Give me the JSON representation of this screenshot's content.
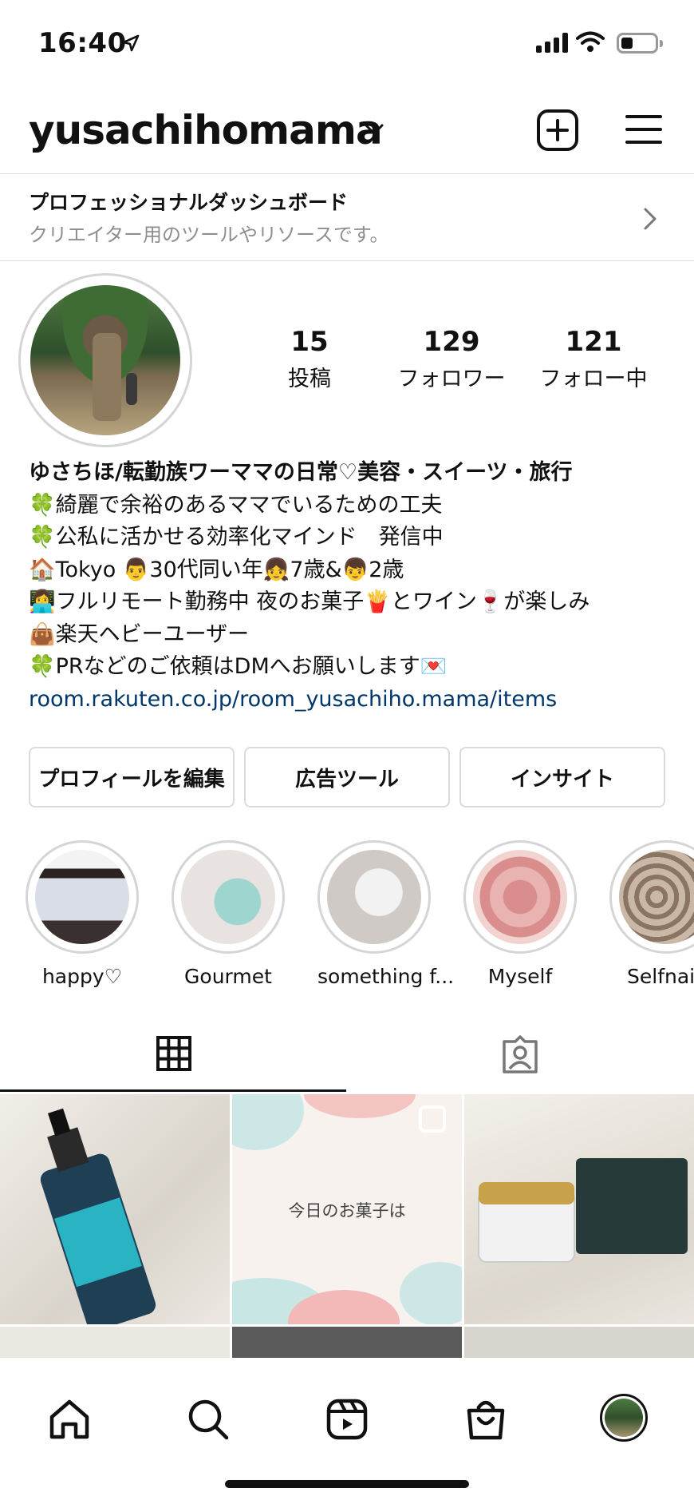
{
  "status": {
    "time": "16:40",
    "battery_level": 0.3
  },
  "header": {
    "username": "yusachihomama"
  },
  "dashboard": {
    "title": "プロフェッショナルダッシュボード",
    "subtitle": "クリエイター用のツールやリソースです。"
  },
  "stats": [
    {
      "value": "15",
      "label": "投稿"
    },
    {
      "value": "129",
      "label": "フォロワー"
    },
    {
      "value": "121",
      "label": "フォロー中"
    }
  ],
  "bio": {
    "name": "ゆさちほ/転勤族ワーママの日常♡美容・スイーツ・旅行",
    "lines": [
      "🍀綺麗で余裕のあるママでいるための工夫",
      "🍀公私に活かせる効率化マインド　発信中",
      "🏠Tokyo 👨30代同い年👧7歳&👦2歳",
      "👩‍💻フルリモート勤務中 夜のお菓子🍟とワイン🍷が楽しみ",
      "👜楽天ヘビーユーザー",
      "🍀PRなどのご依頼はDMへお願いします💌"
    ],
    "link": "room.rakuten.co.jp/room_yusachiho.mama/items"
  },
  "buttons": {
    "edit_profile": "プロフィールを編集",
    "ad_tools": "広告ツール",
    "insights": "インサイト"
  },
  "highlights": [
    {
      "label": "happy♡"
    },
    {
      "label": "Gourmet"
    },
    {
      "label": "something f..."
    },
    {
      "label": "Myself"
    },
    {
      "label": "Selfnai"
    }
  ],
  "posts": [
    {
      "text": ""
    },
    {
      "text": "今日のお菓子は"
    },
    {
      "text": ""
    }
  ],
  "icons": {
    "location": "location-arrow-icon",
    "dropdown": "chevron-down-icon",
    "new_post": "plus-square-icon",
    "menu": "hamburger-menu-icon",
    "grid": "grid-icon",
    "tagged": "tagged-person-icon",
    "home": "home-icon",
    "search": "search-icon",
    "reels": "reels-icon",
    "shop": "shop-bag-icon"
  }
}
